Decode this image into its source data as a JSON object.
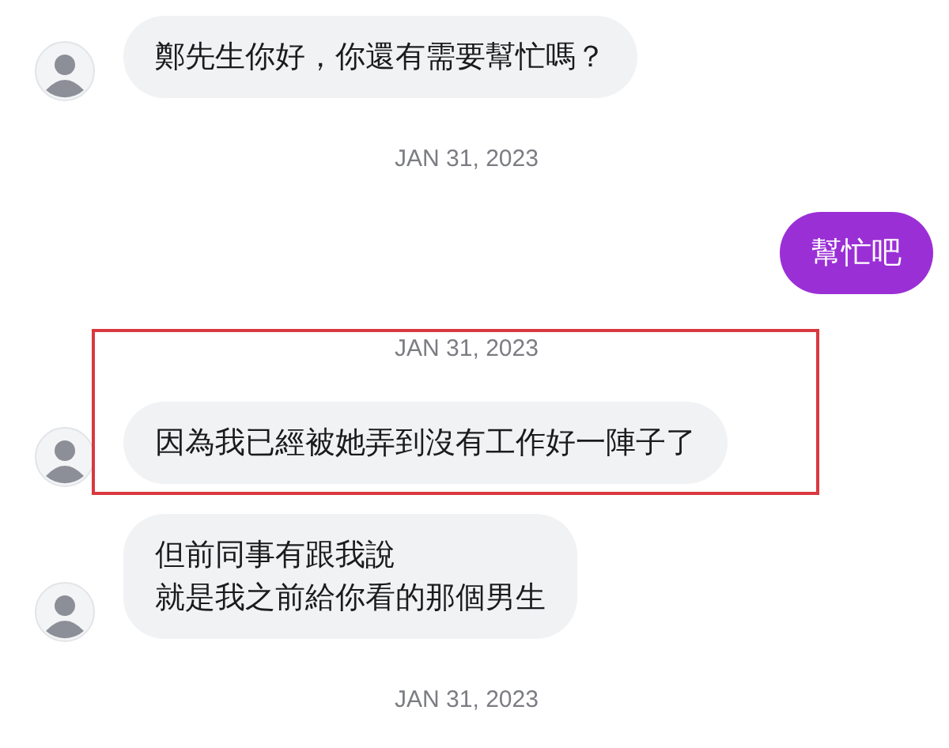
{
  "conversation": [
    {
      "kind": "message",
      "outgoing": false,
      "lines": [
        "鄭先生你好，你還有需要幫忙嗎？"
      ]
    },
    {
      "kind": "date",
      "text": "JAN 31, 2023"
    },
    {
      "kind": "message",
      "outgoing": true,
      "lines": [
        "幫忙吧"
      ]
    },
    {
      "kind": "highlight",
      "items": [
        {
          "kind": "date",
          "text": "JAN 31, 2023"
        },
        {
          "kind": "message",
          "outgoing": false,
          "lines": [
            "因為我已經被她弄到沒有工作好一陣子了"
          ]
        }
      ]
    },
    {
      "kind": "message",
      "outgoing": false,
      "lines": [
        "但前同事有跟我說",
        "就是我之前給你看的那個男生"
      ]
    },
    {
      "kind": "date",
      "text": "JAN 31, 2023"
    }
  ]
}
